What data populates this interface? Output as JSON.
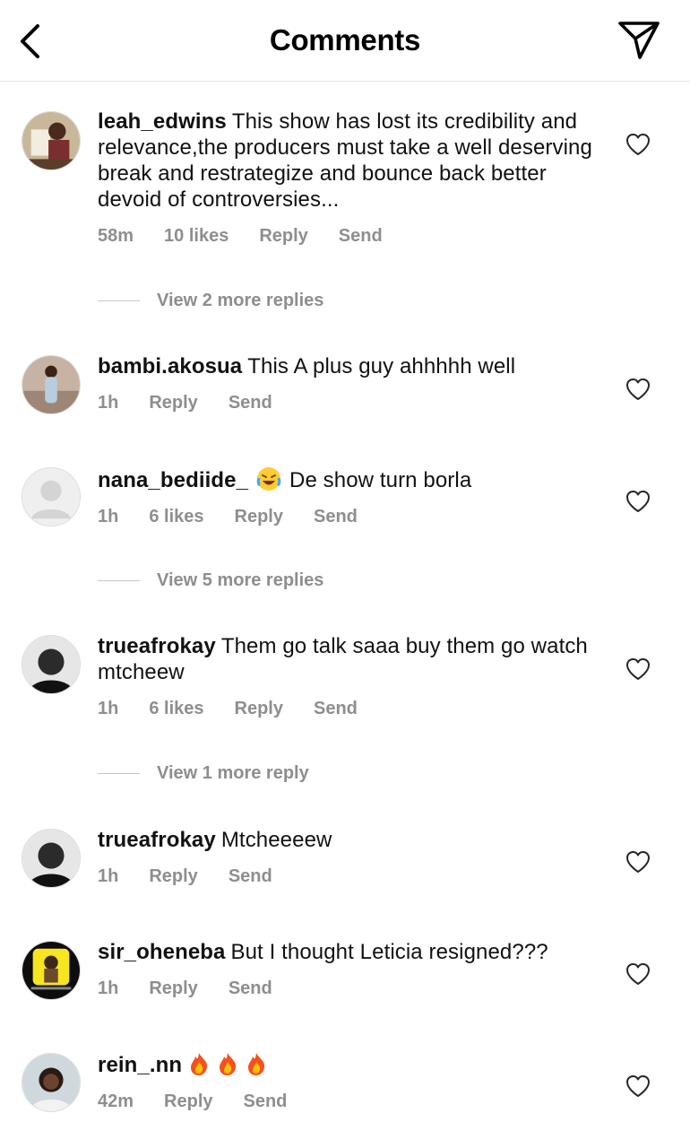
{
  "header": {
    "title": "Comments"
  },
  "comments": [
    {
      "username": "leah_edwins",
      "text": "This show has lost its credibility and relevance,the producers must take a well deserving break and restrategize and bounce back better devoid of controversies...",
      "time": "58m",
      "likes": "10 likes",
      "reply": "Reply",
      "send": "Send",
      "view_replies": "View 2 more replies"
    },
    {
      "username": "bambi.akosua",
      "text": "This A plus guy ahhhhh well",
      "time": "1h",
      "reply": "Reply",
      "send": "Send"
    },
    {
      "username": "nana_bediide_",
      "text": "De show turn borla",
      "emoji": "face-with-tears-of-joy",
      "time": "1h",
      "likes": "6 likes",
      "reply": "Reply",
      "send": "Send",
      "view_replies": "View 5 more replies"
    },
    {
      "username": "trueafrokay",
      "text": "Them go talk saaa buy them go watch mtcheew",
      "time": "1h",
      "likes": "6 likes",
      "reply": "Reply",
      "send": "Send",
      "view_replies": "View 1 more reply"
    },
    {
      "username": "trueafrokay",
      "text": "Mtcheeeew",
      "time": "1h",
      "reply": "Reply",
      "send": "Send"
    },
    {
      "username": "sir_oheneba",
      "text": "But I thought Leticia resigned???",
      "time": "1h",
      "reply": "Reply",
      "send": "Send"
    },
    {
      "username": "rein_.nn",
      "text": "",
      "emoji": "fire x3",
      "time": "42m",
      "reply": "Reply",
      "send": "Send"
    }
  ],
  "icons": {
    "back": "chevron-left-icon",
    "share": "paper-plane-icon",
    "like": "heart-outline-icon"
  },
  "colors": {
    "text": "#111111",
    "meta": "#8e8e8e",
    "divider": "#e6e6e6"
  }
}
